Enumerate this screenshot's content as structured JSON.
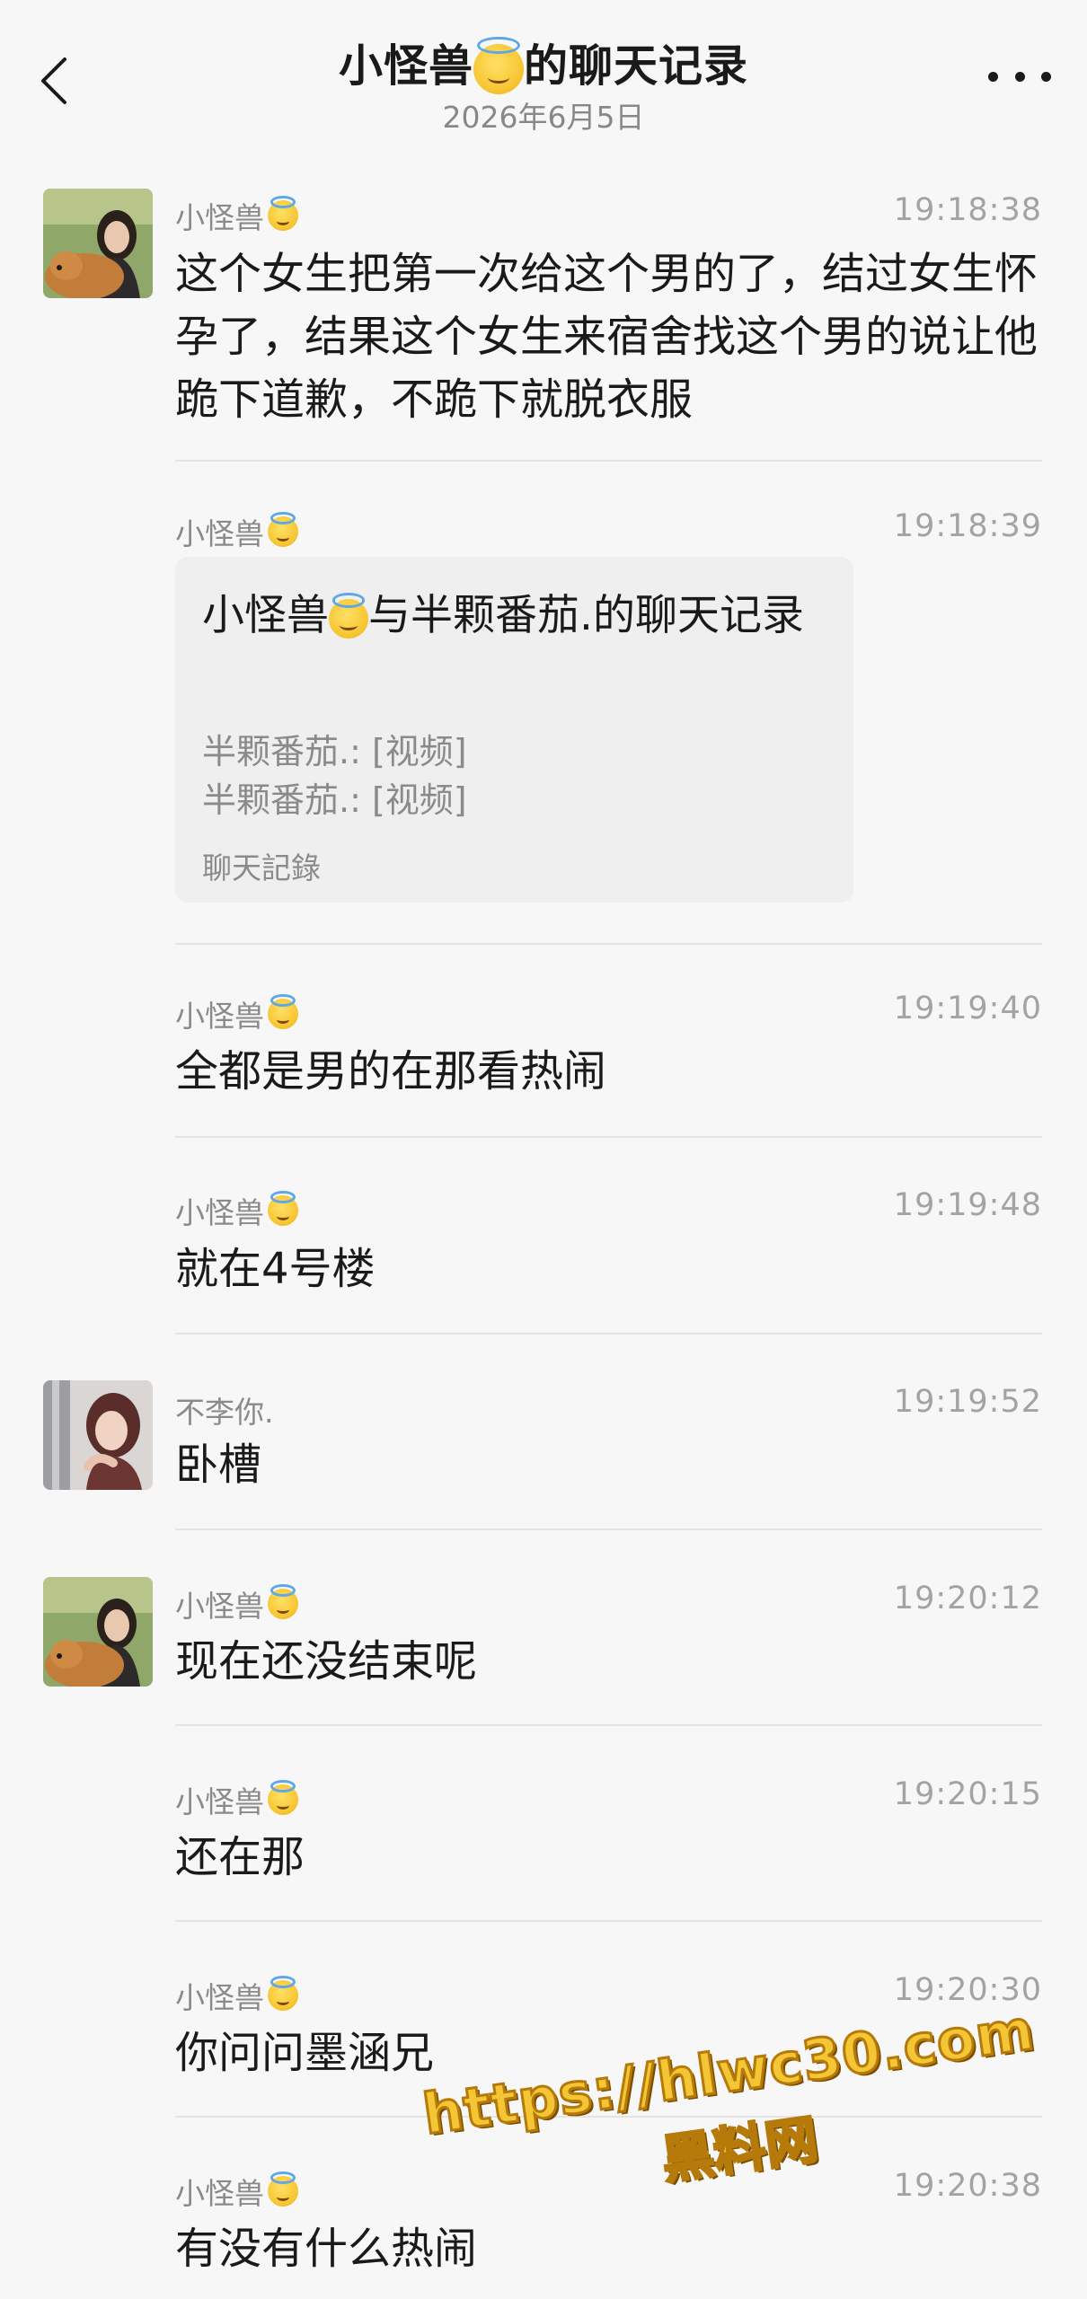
{
  "header": {
    "title": "小怪兽",
    "title_suffix": "的聊天记录",
    "subtitle": "2026年6月5日"
  },
  "messages": [
    {
      "sender": "小怪兽",
      "time": "19:18:38",
      "text": "这个女生把第一次给这个男的了，结过女生怀孕了，结果这个女生来宿舍找这个男的说让他跪下道歉，不跪下就脱衣服",
      "avatar": "girl-with-dog-avatar"
    },
    {
      "sender": "小怪兽",
      "time": "19:18:39"
    },
    {
      "sender": "小怪兽",
      "time": "19:19:40",
      "text": "全都是男的在那看热闹"
    },
    {
      "sender": "小怪兽",
      "time": "19:19:48",
      "text": "就在4号楼"
    },
    {
      "sender": "不李你.",
      "time": "19:19:52",
      "text": "卧槽",
      "avatar": "girl-portrait-avatar"
    },
    {
      "sender": "小怪兽",
      "time": "19:20:12",
      "text": "现在还没结束呢",
      "avatar": "girl-with-dog-avatar"
    },
    {
      "sender": "小怪兽",
      "time": "19:20:15",
      "text": "还在那"
    },
    {
      "sender": "小怪兽",
      "time": "19:20:30",
      "text": "你问问墨涵兄"
    },
    {
      "sender": "小怪兽",
      "time": "19:20:38",
      "text": "有没有什么热闹"
    }
  ],
  "chat_record_card": {
    "title_a": "小怪兽",
    "title_b": "与半颗番茄.的聊天记录",
    "lines": [
      "半颗番茄.: [视频]",
      "半颗番茄.: [视频]"
    ],
    "footer": "聊天記錄"
  },
  "watermark": {
    "url": "https://hlwc30.com",
    "site": "黑料网"
  },
  "colors": {
    "background": "#f7f7f7",
    "card": "#efefef",
    "secondary_text": "#8a8a8a",
    "watermark": "#f4c534"
  },
  "icons": [
    "back-chevron-icon",
    "more-dots-icon",
    "angel-emoji-icon"
  ]
}
